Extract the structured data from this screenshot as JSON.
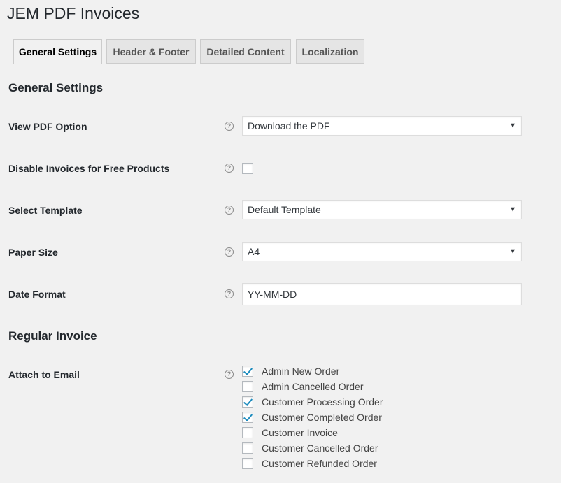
{
  "page": {
    "title": "JEM PDF Invoices"
  },
  "tabs": [
    {
      "label": "General Settings",
      "active": true
    },
    {
      "label": "Header & Footer",
      "active": false
    },
    {
      "label": "Detailed Content",
      "active": false
    },
    {
      "label": "Localization",
      "active": false
    }
  ],
  "general": {
    "section_title": "General Settings",
    "help_glyph": "?",
    "view_pdf": {
      "label": "View PDF Option",
      "value": "Download the PDF"
    },
    "disable_free": {
      "label": "Disable Invoices for Free Products",
      "checked": false
    },
    "template": {
      "label": "Select Template",
      "value": "Default Template"
    },
    "paper": {
      "label": "Paper Size",
      "value": "A4"
    },
    "date_format": {
      "label": "Date Format",
      "value": "YY-MM-DD"
    }
  },
  "regular": {
    "section_title": "Regular Invoice",
    "attach": {
      "label": "Attach to Email",
      "options": [
        {
          "label": "Admin New Order",
          "checked": true
        },
        {
          "label": "Admin Cancelled Order",
          "checked": false
        },
        {
          "label": "Customer Processing Order",
          "checked": true
        },
        {
          "label": "Customer Completed Order",
          "checked": true
        },
        {
          "label": "Customer Invoice",
          "checked": false
        },
        {
          "label": "Customer Cancelled Order",
          "checked": false
        },
        {
          "label": "Customer Refunded Order",
          "checked": false
        }
      ]
    }
  },
  "colors": {
    "background": "#f1f1f1",
    "tab_inactive": "#e5e5e5",
    "check_mark": "#1e8cbe"
  },
  "icons": {
    "help": "question-circle-icon",
    "dropdown": "triangle-down-icon",
    "dropdown_glyph": "▼"
  }
}
